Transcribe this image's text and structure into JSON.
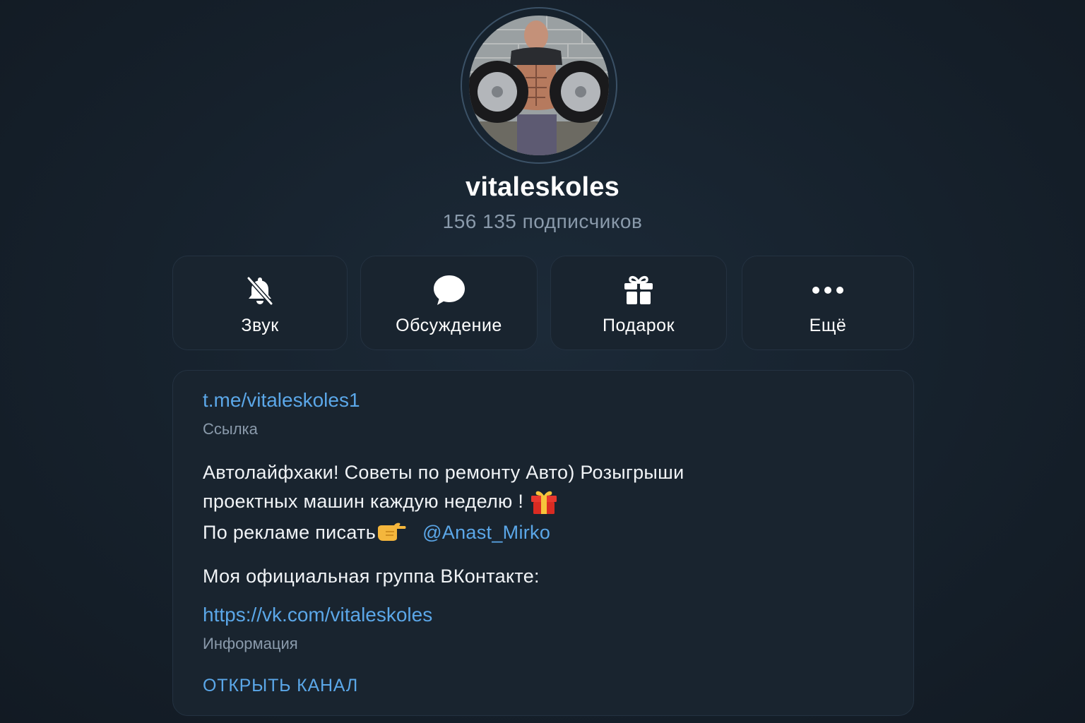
{
  "channel": {
    "name": "vitaleskoles",
    "subscribers": "156 135 подписчиков"
  },
  "actions": [
    {
      "label": "Звук",
      "icon": "bell-muted-icon"
    },
    {
      "label": "Обсуждение",
      "icon": "chat-bubble-icon"
    },
    {
      "label": "Подарок",
      "icon": "gift-icon"
    },
    {
      "label": "Ещё",
      "icon": "more-dots-icon"
    }
  ],
  "info": {
    "link": "t.me/vitaleskoles1",
    "link_caption": "Ссылка",
    "description": {
      "line1": "Автолайфхаки! Советы по ремонту Авто) Розыгрыши",
      "line2": "проектных машин каждую неделю ! ",
      "line3": "По рекламе писать",
      "mention": "@Anast_Mirko"
    },
    "vk_title": "Моя официальная группа ВКонтакте:",
    "vk_link": "https://vk.com/vitaleskoles",
    "info_caption": "Информация",
    "open_channel": "ОТКРЫТЬ КАНАЛ"
  },
  "colors": {
    "background": "#16212c",
    "card": "#19242f",
    "accent_link": "#5ba7e8",
    "muted_text": "#8a9aab"
  }
}
